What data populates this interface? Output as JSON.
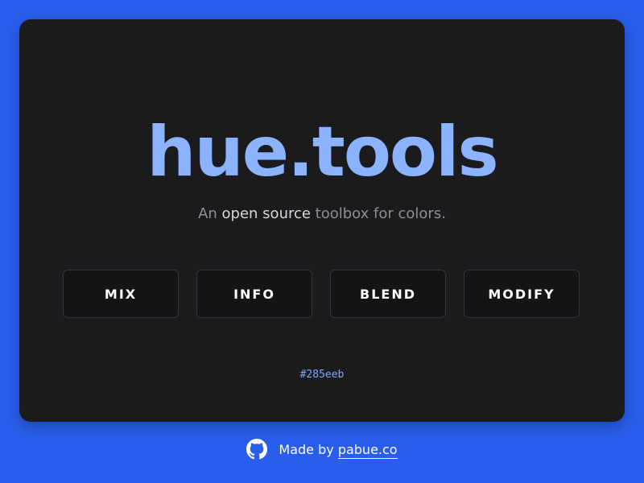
{
  "colors": {
    "background": "#285eeb",
    "card": "#1b1b1d",
    "title": "#8cb3ff",
    "tagline_muted": "#8f8f93",
    "tagline_highlight": "#d9d9dc",
    "hex_text": "#7fa6ff"
  },
  "header": {
    "title": "hue.tools",
    "tagline_prefix": "An ",
    "tagline_highlight": "open source",
    "tagline_suffix": " toolbox for colors."
  },
  "tools": [
    {
      "label": "MIX"
    },
    {
      "label": "INFO"
    },
    {
      "label": "BLEND"
    },
    {
      "label": "MODIFY"
    }
  ],
  "current_color": "#285eeb",
  "footer": {
    "icon": "github-icon",
    "made_by_prefix": "Made by ",
    "made_by_link": "pabue.co"
  }
}
